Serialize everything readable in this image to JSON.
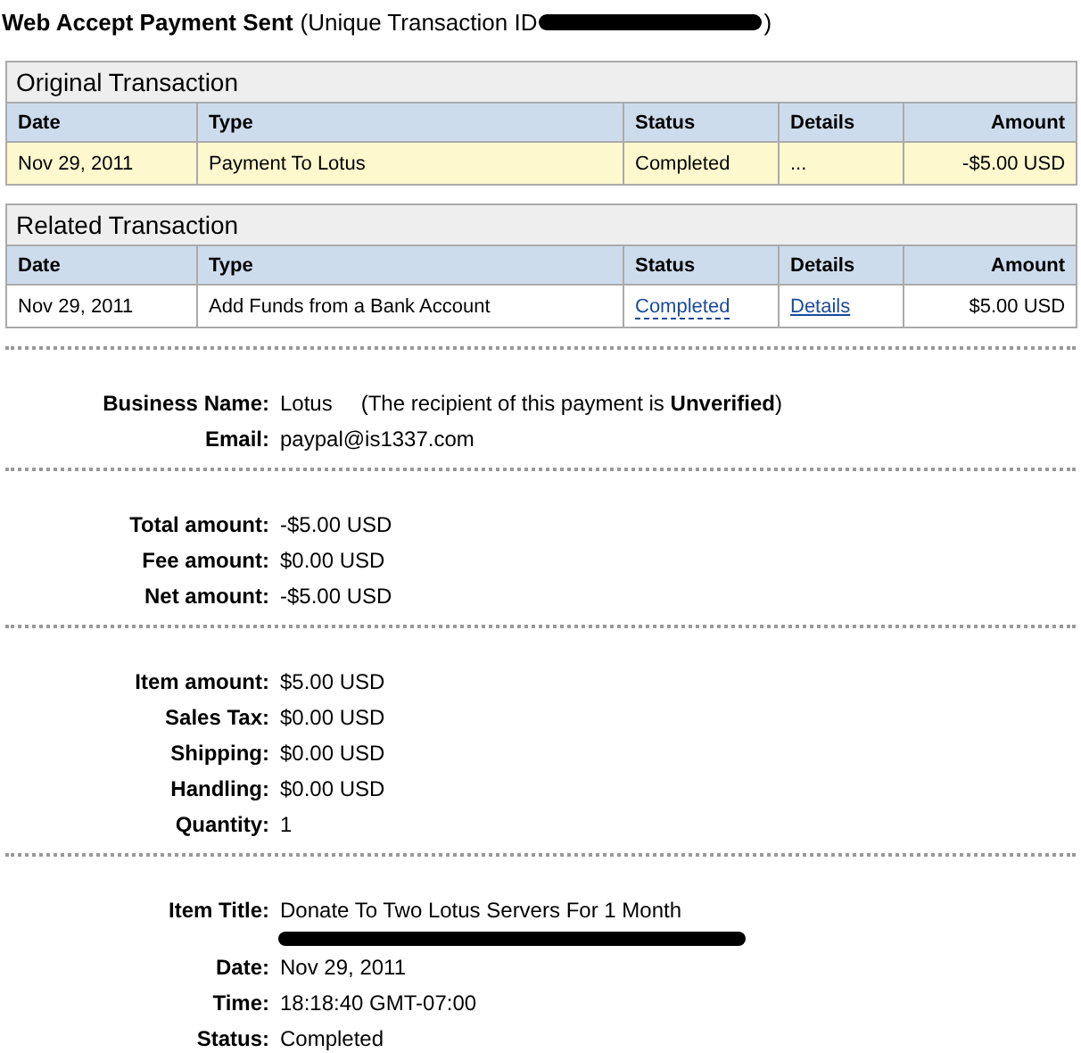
{
  "header": {
    "title": "Web Accept Payment Sent",
    "id_label": "(Unique Transaction ID",
    "id_close": ")"
  },
  "tables": [
    {
      "caption": "Original Transaction",
      "columns": [
        "Date",
        "Type",
        "Status",
        "Details",
        "Amount"
      ],
      "rows": [
        {
          "highlighted": true,
          "cells": [
            {
              "kind": "text",
              "text": "Nov 29, 2011"
            },
            {
              "kind": "text",
              "text": "Payment To Lotus"
            },
            {
              "kind": "text",
              "text": "Completed"
            },
            {
              "kind": "text",
              "text": "..."
            },
            {
              "kind": "text",
              "text": "-$5.00 USD"
            }
          ]
        }
      ]
    },
    {
      "caption": "Related Transaction",
      "columns": [
        "Date",
        "Type",
        "Status",
        "Details",
        "Amount"
      ],
      "rows": [
        {
          "highlighted": false,
          "cells": [
            {
              "kind": "text",
              "text": "Nov 29, 2011"
            },
            {
              "kind": "text",
              "text": "Add Funds from a Bank Account"
            },
            {
              "kind": "status-link",
              "text": "Completed"
            },
            {
              "kind": "link",
              "text": "Details"
            },
            {
              "kind": "text",
              "text": "$5.00 USD"
            }
          ]
        }
      ]
    }
  ],
  "sections": [
    {
      "fields": [
        {
          "kind": "value",
          "label": "Business Name:",
          "value": "Lotus",
          "note": "(The recipient of this payment is **Unverified**)"
        },
        {
          "kind": "value",
          "label": "Email:",
          "value": "paypal@is1337.com"
        }
      ]
    },
    {
      "fields": [
        {
          "kind": "value",
          "label": "Total amount:",
          "value": "-$5.00 USD"
        },
        {
          "kind": "value",
          "label": "Fee amount:",
          "value": "$0.00 USD"
        },
        {
          "kind": "value",
          "label": "Net amount:",
          "value": "-$5.00 USD"
        }
      ]
    },
    {
      "fields": [
        {
          "kind": "value",
          "label": "Item amount:",
          "value": "$5.00 USD"
        },
        {
          "kind": "value",
          "label": "Sales Tax:",
          "value": "$0.00 USD"
        },
        {
          "kind": "value",
          "label": "Shipping:",
          "value": "$0.00 USD"
        },
        {
          "kind": "value",
          "label": "Handling:",
          "value": "$0.00 USD"
        },
        {
          "kind": "value",
          "label": "Quantity:",
          "value": "1"
        }
      ]
    },
    {
      "fields": [
        {
          "kind": "value",
          "label": "Item Title:",
          "value": "Donate To Two Lotus Servers For 1 Month"
        },
        {
          "kind": "redacted"
        },
        {
          "kind": "value",
          "label": "Date:",
          "value": "Nov 29, 2011"
        },
        {
          "kind": "value",
          "label": "Time:",
          "value": "18:18:40 GMT-07:00"
        },
        {
          "kind": "value",
          "label": "Status:",
          "value": "Completed"
        }
      ]
    }
  ]
}
